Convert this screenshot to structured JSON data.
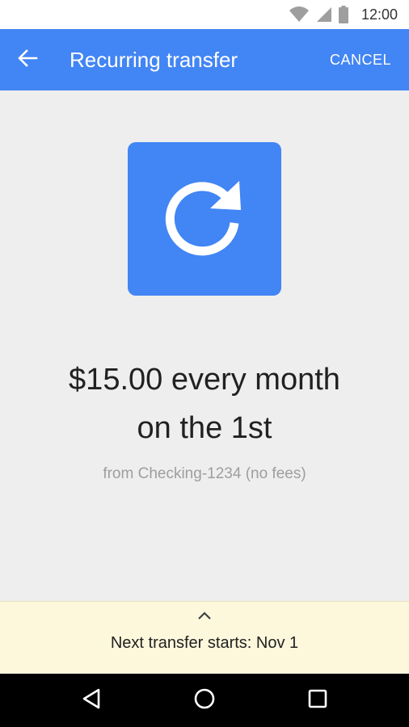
{
  "status_bar": {
    "time": "12:00",
    "icons": [
      "wifi-icon",
      "signal-icon",
      "battery-icon"
    ]
  },
  "app_bar": {
    "title": "Recurring transfer",
    "back_icon": "arrow-left-icon",
    "cancel_label": "CANCEL",
    "color": "#4285f4"
  },
  "hero": {
    "icon": "refresh-icon",
    "color": "#4285f4"
  },
  "summary": {
    "line1": "$15.00 every month",
    "line2": "on the 1st",
    "source": "from Checking-1234 (no fees)"
  },
  "sheet": {
    "handle_icon": "chevron-up-icon",
    "text": "Next transfer starts: Nov 1",
    "background": "#fdf8dc"
  },
  "nav_bar": {
    "buttons": [
      "back-triangle-icon",
      "home-circle-icon",
      "recents-square-icon"
    ]
  }
}
